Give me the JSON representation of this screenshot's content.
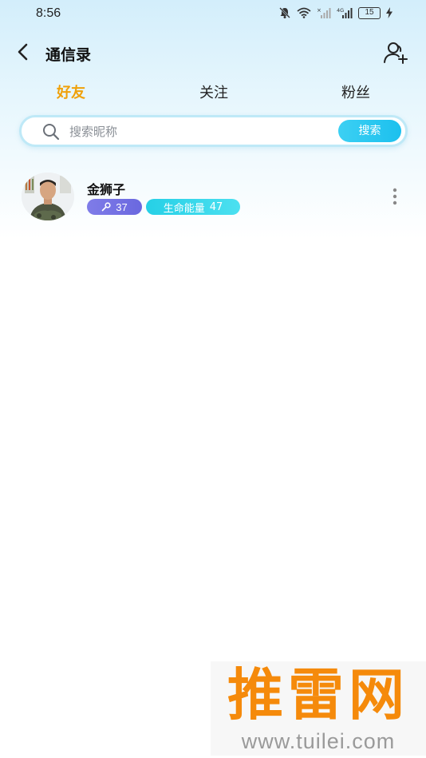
{
  "status_bar": {
    "time": "8:56",
    "signal_label": "4G",
    "battery": "15",
    "icons": [
      "mute-bell-icon",
      "wifi-icon",
      "signal-x-icon",
      "signal-4g-icon",
      "battery-icon",
      "charging-icon"
    ]
  },
  "nav": {
    "title": "通信录",
    "back_icon": "chevron-left-icon",
    "add_icon": "add-user-icon"
  },
  "tabs": [
    {
      "label": "好友",
      "active": true
    },
    {
      "label": "关注",
      "active": false
    },
    {
      "label": "粉丝",
      "active": false
    }
  ],
  "search": {
    "placeholder": "搜索昵称",
    "value": "",
    "button_label": "搜索"
  },
  "friends": [
    {
      "name": "金狮子",
      "key_value": "37",
      "energy_label": "生命能量",
      "energy_value": "47"
    }
  ],
  "watermark": {
    "main": "推雷网",
    "sub": "www.tuilei.com"
  },
  "colors": {
    "accent_tab": "#f0a10a",
    "search_button": "#1cc0ee",
    "badge_key": "#6a68df",
    "badge_energy": "#26d0e6",
    "watermark": "#f58a0b"
  }
}
